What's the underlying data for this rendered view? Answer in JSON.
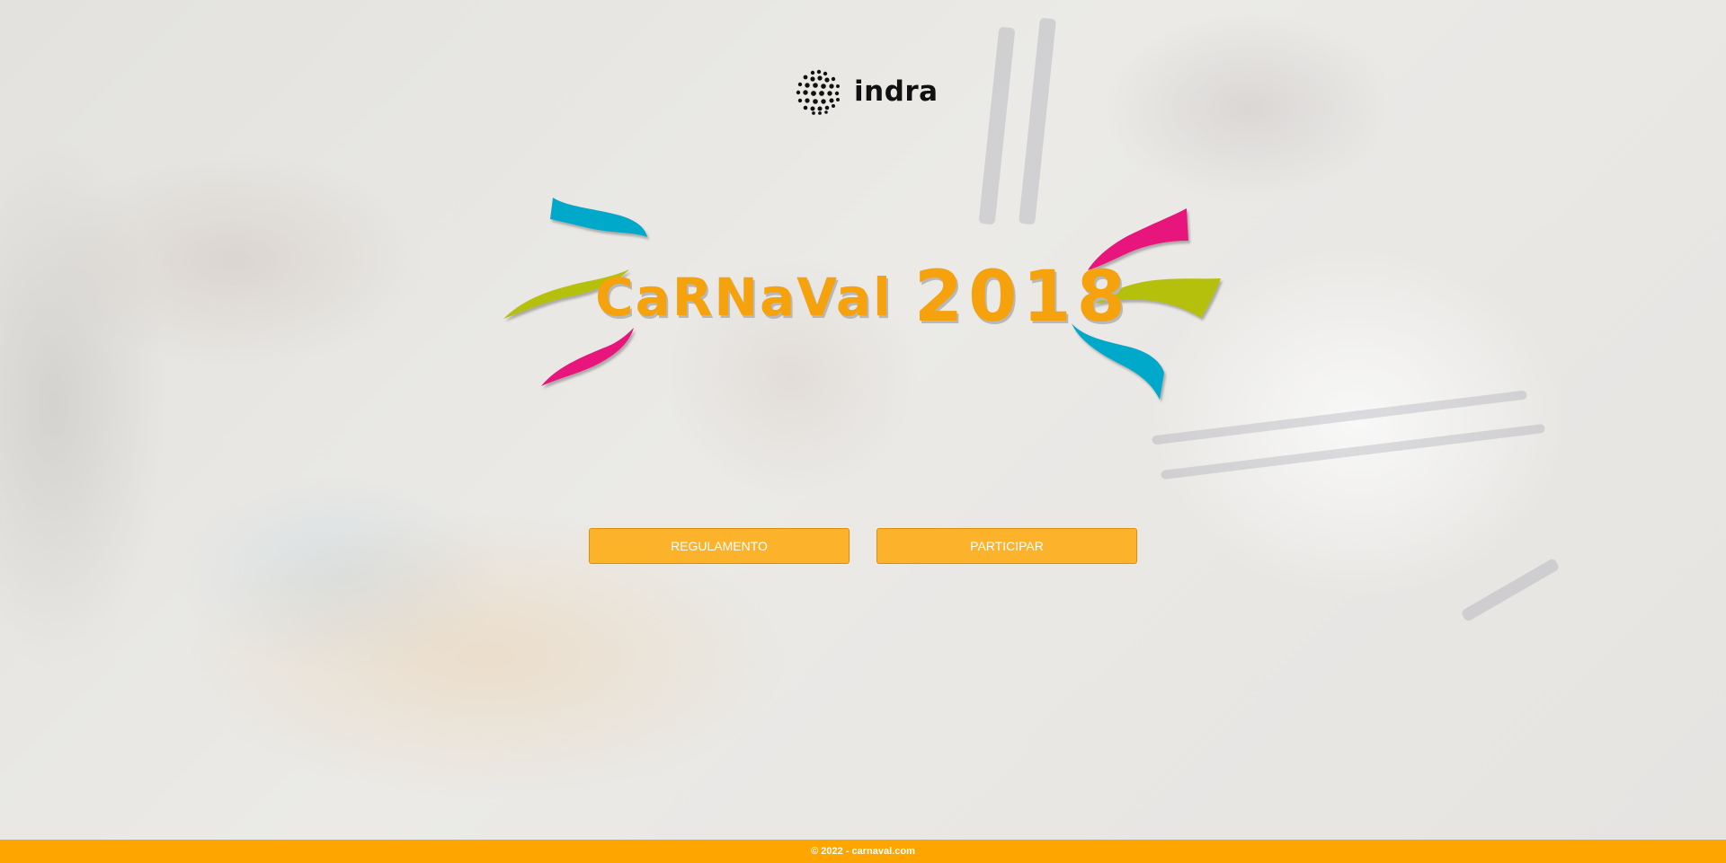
{
  "brand": {
    "logo_text": "indra",
    "logo_icon": "dotted-sphere-icon"
  },
  "hero": {
    "title_word": "CaRNaVal",
    "title_year": "2018",
    "ribbon_colors": {
      "cyan": "#00a9c9",
      "lime": "#b5c00a",
      "magenta": "#e8177b"
    },
    "title_color": "#f5a20d"
  },
  "actions": {
    "regulamento_label": "REGULAMENTO",
    "participar_label": "PARTICIPAR"
  },
  "footer": {
    "copyright": "© 2022 - carnaval.com"
  },
  "colors": {
    "accent": "#ffa500",
    "button_bg": "#ffaa0c"
  }
}
